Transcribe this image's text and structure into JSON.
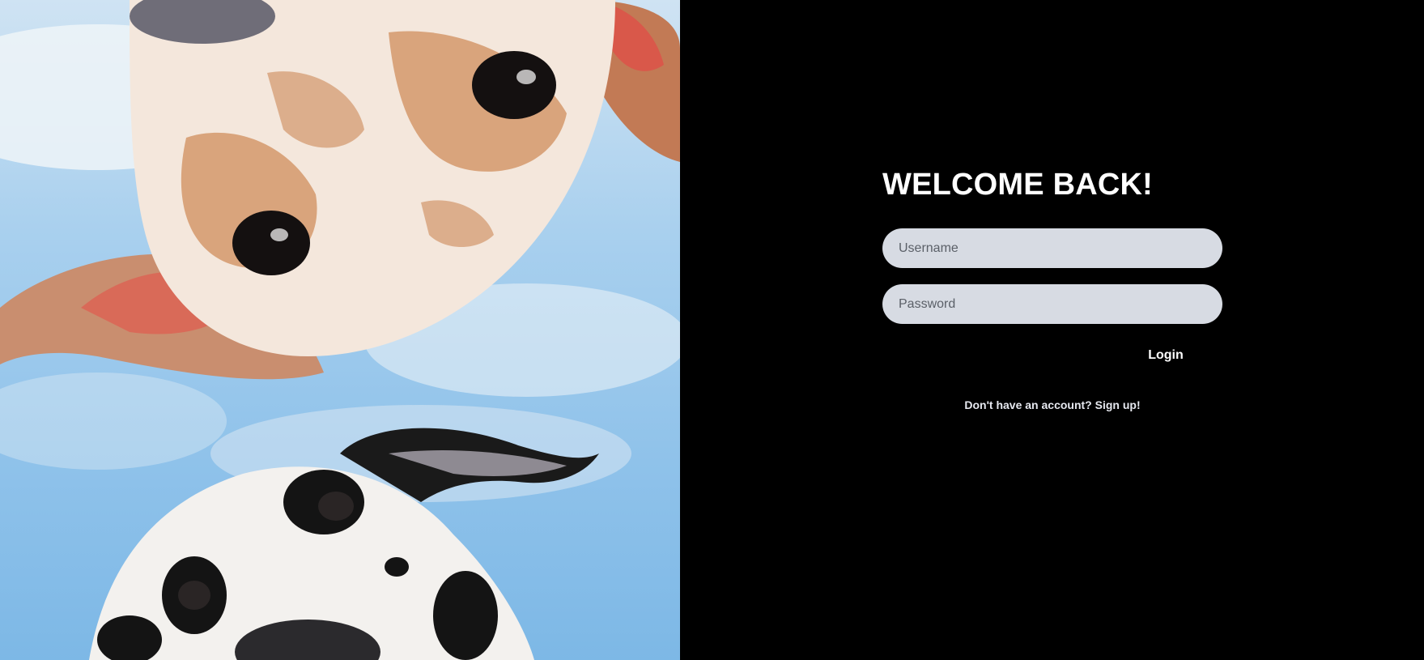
{
  "login": {
    "title": "WELCOME BACK!",
    "username_placeholder": "Username",
    "password_placeholder": "Password",
    "login_label": "Login",
    "signup_text": "Don't have an account? Sign up!"
  },
  "photo": {
    "subject": "two dogs looking down into camera against blue sky"
  },
  "colors": {
    "background": "#000000",
    "input_bg": "#d7dbe3",
    "text": "#ffffff",
    "sky": "#8fc2ea"
  }
}
